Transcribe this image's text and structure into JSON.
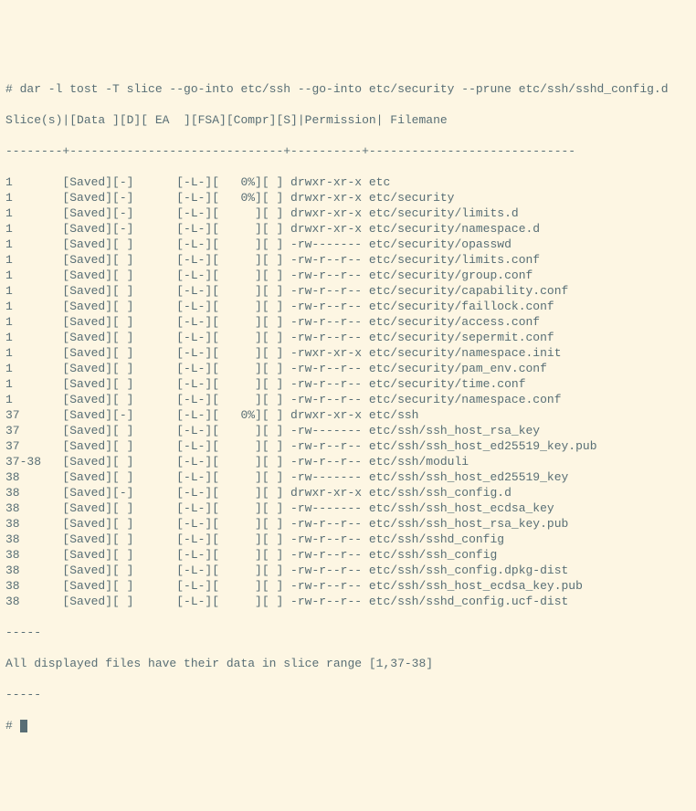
{
  "command": "# dar -l tost -T slice --go-into etc/ssh --go-into etc/security --prune etc/ssh/sshd_config.d",
  "header": "Slice(s)|[Data ][D][ EA  ][FSA][Compr][S]|Permission| Filemane",
  "separator": "--------+------------------------------+----------+-----------------------------",
  "rows": [
    {
      "slice": "1",
      "data": "[Saved]",
      "d": "[-]",
      "ea": "",
      "fsa": "[-L-]",
      "compr": "[   0%]",
      "s": "[ ]",
      "perm": "drwxr-xr-x",
      "file": "etc"
    },
    {
      "slice": "1",
      "data": "[Saved]",
      "d": "[-]",
      "ea": "",
      "fsa": "[-L-]",
      "compr": "[   0%]",
      "s": "[ ]",
      "perm": "drwxr-xr-x",
      "file": "etc/security"
    },
    {
      "slice": "1",
      "data": "[Saved]",
      "d": "[-]",
      "ea": "",
      "fsa": "[-L-]",
      "compr": "[     ]",
      "s": "[ ]",
      "perm": "drwxr-xr-x",
      "file": "etc/security/limits.d"
    },
    {
      "slice": "1",
      "data": "[Saved]",
      "d": "[-]",
      "ea": "",
      "fsa": "[-L-]",
      "compr": "[     ]",
      "s": "[ ]",
      "perm": "drwxr-xr-x",
      "file": "etc/security/namespace.d"
    },
    {
      "slice": "1",
      "data": "[Saved]",
      "d": "[ ]",
      "ea": "",
      "fsa": "[-L-]",
      "compr": "[     ]",
      "s": "[ ]",
      "perm": "-rw-------",
      "file": "etc/security/opasswd"
    },
    {
      "slice": "1",
      "data": "[Saved]",
      "d": "[ ]",
      "ea": "",
      "fsa": "[-L-]",
      "compr": "[     ]",
      "s": "[ ]",
      "perm": "-rw-r--r--",
      "file": "etc/security/limits.conf"
    },
    {
      "slice": "1",
      "data": "[Saved]",
      "d": "[ ]",
      "ea": "",
      "fsa": "[-L-]",
      "compr": "[     ]",
      "s": "[ ]",
      "perm": "-rw-r--r--",
      "file": "etc/security/group.conf"
    },
    {
      "slice": "1",
      "data": "[Saved]",
      "d": "[ ]",
      "ea": "",
      "fsa": "[-L-]",
      "compr": "[     ]",
      "s": "[ ]",
      "perm": "-rw-r--r--",
      "file": "etc/security/capability.conf"
    },
    {
      "slice": "1",
      "data": "[Saved]",
      "d": "[ ]",
      "ea": "",
      "fsa": "[-L-]",
      "compr": "[     ]",
      "s": "[ ]",
      "perm": "-rw-r--r--",
      "file": "etc/security/faillock.conf"
    },
    {
      "slice": "1",
      "data": "[Saved]",
      "d": "[ ]",
      "ea": "",
      "fsa": "[-L-]",
      "compr": "[     ]",
      "s": "[ ]",
      "perm": "-rw-r--r--",
      "file": "etc/security/access.conf"
    },
    {
      "slice": "1",
      "data": "[Saved]",
      "d": "[ ]",
      "ea": "",
      "fsa": "[-L-]",
      "compr": "[     ]",
      "s": "[ ]",
      "perm": "-rw-r--r--",
      "file": "etc/security/sepermit.conf"
    },
    {
      "slice": "1",
      "data": "[Saved]",
      "d": "[ ]",
      "ea": "",
      "fsa": "[-L-]",
      "compr": "[     ]",
      "s": "[ ]",
      "perm": "-rwxr-xr-x",
      "file": "etc/security/namespace.init"
    },
    {
      "slice": "1",
      "data": "[Saved]",
      "d": "[ ]",
      "ea": "",
      "fsa": "[-L-]",
      "compr": "[     ]",
      "s": "[ ]",
      "perm": "-rw-r--r--",
      "file": "etc/security/pam_env.conf"
    },
    {
      "slice": "1",
      "data": "[Saved]",
      "d": "[ ]",
      "ea": "",
      "fsa": "[-L-]",
      "compr": "[     ]",
      "s": "[ ]",
      "perm": "-rw-r--r--",
      "file": "etc/security/time.conf"
    },
    {
      "slice": "1",
      "data": "[Saved]",
      "d": "[ ]",
      "ea": "",
      "fsa": "[-L-]",
      "compr": "[     ]",
      "s": "[ ]",
      "perm": "-rw-r--r--",
      "file": "etc/security/namespace.conf"
    },
    {
      "slice": "37",
      "data": "[Saved]",
      "d": "[-]",
      "ea": "",
      "fsa": "[-L-]",
      "compr": "[   0%]",
      "s": "[ ]",
      "perm": "drwxr-xr-x",
      "file": "etc/ssh"
    },
    {
      "slice": "37",
      "data": "[Saved]",
      "d": "[ ]",
      "ea": "",
      "fsa": "[-L-]",
      "compr": "[     ]",
      "s": "[ ]",
      "perm": "-rw-------",
      "file": "etc/ssh/ssh_host_rsa_key"
    },
    {
      "slice": "37",
      "data": "[Saved]",
      "d": "[ ]",
      "ea": "",
      "fsa": "[-L-]",
      "compr": "[     ]",
      "s": "[ ]",
      "perm": "-rw-r--r--",
      "file": "etc/ssh/ssh_host_ed25519_key.pub"
    },
    {
      "slice": "37-38",
      "data": "[Saved]",
      "d": "[ ]",
      "ea": "",
      "fsa": "[-L-]",
      "compr": "[     ]",
      "s": "[ ]",
      "perm": "-rw-r--r--",
      "file": "etc/ssh/moduli"
    },
    {
      "slice": "38",
      "data": "[Saved]",
      "d": "[ ]",
      "ea": "",
      "fsa": "[-L-]",
      "compr": "[     ]",
      "s": "[ ]",
      "perm": "-rw-------",
      "file": "etc/ssh/ssh_host_ed25519_key"
    },
    {
      "slice": "38",
      "data": "[Saved]",
      "d": "[-]",
      "ea": "",
      "fsa": "[-L-]",
      "compr": "[     ]",
      "s": "[ ]",
      "perm": "drwxr-xr-x",
      "file": "etc/ssh/ssh_config.d"
    },
    {
      "slice": "38",
      "data": "[Saved]",
      "d": "[ ]",
      "ea": "",
      "fsa": "[-L-]",
      "compr": "[     ]",
      "s": "[ ]",
      "perm": "-rw-------",
      "file": "etc/ssh/ssh_host_ecdsa_key"
    },
    {
      "slice": "38",
      "data": "[Saved]",
      "d": "[ ]",
      "ea": "",
      "fsa": "[-L-]",
      "compr": "[     ]",
      "s": "[ ]",
      "perm": "-rw-r--r--",
      "file": "etc/ssh/ssh_host_rsa_key.pub"
    },
    {
      "slice": "38",
      "data": "[Saved]",
      "d": "[ ]",
      "ea": "",
      "fsa": "[-L-]",
      "compr": "[     ]",
      "s": "[ ]",
      "perm": "-rw-r--r--",
      "file": "etc/ssh/sshd_config"
    },
    {
      "slice": "38",
      "data": "[Saved]",
      "d": "[ ]",
      "ea": "",
      "fsa": "[-L-]",
      "compr": "[     ]",
      "s": "[ ]",
      "perm": "-rw-r--r--",
      "file": "etc/ssh/ssh_config"
    },
    {
      "slice": "38",
      "data": "[Saved]",
      "d": "[ ]",
      "ea": "",
      "fsa": "[-L-]",
      "compr": "[     ]",
      "s": "[ ]",
      "perm": "-rw-r--r--",
      "file": "etc/ssh/ssh_config.dpkg-dist"
    },
    {
      "slice": "38",
      "data": "[Saved]",
      "d": "[ ]",
      "ea": "",
      "fsa": "[-L-]",
      "compr": "[     ]",
      "s": "[ ]",
      "perm": "-rw-r--r--",
      "file": "etc/ssh/ssh_host_ecdsa_key.pub"
    },
    {
      "slice": "38",
      "data": "[Saved]",
      "d": "[ ]",
      "ea": "",
      "fsa": "[-L-]",
      "compr": "[     ]",
      "s": "[ ]",
      "perm": "-rw-r--r--",
      "file": "etc/ssh/sshd_config.ucf-dist"
    }
  ],
  "footer_dash": "-----",
  "footer_msg": "All displayed files have their data in slice range [1,37-38]",
  "prompt": "# "
}
